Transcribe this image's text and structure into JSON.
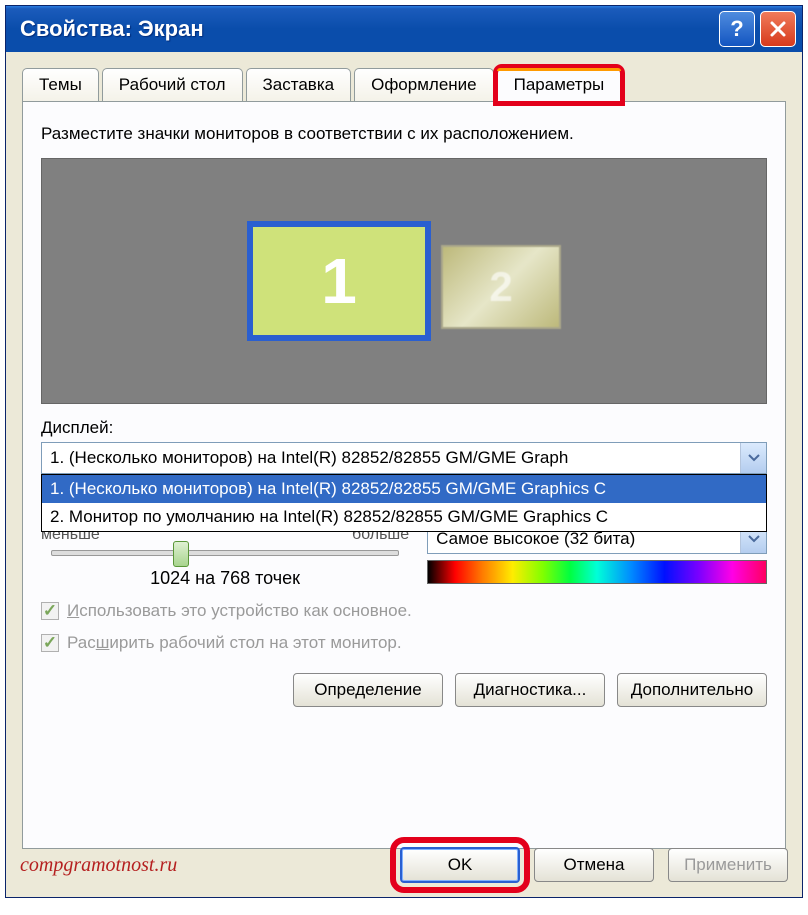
{
  "window": {
    "title": "Свойства: Экран"
  },
  "tabs": {
    "themes": "Темы",
    "desktop": "Рабочий стол",
    "screensaver": "Заставка",
    "appearance": "Оформление",
    "settings": "Параметры"
  },
  "panel": {
    "instruction": "Разместите значки мониторов в соответствии с их расположением.",
    "mon1": "1",
    "mon2": "2",
    "display_label": "Дисплей:",
    "display_value": "1. (Несколько мониторов) на Intel(R) 82852/82855 GM/GME Graph",
    "dropdown": {
      "opt1": "1. (Несколько мониторов) на Intel(R) 82852/82855 GM/GME Graphics C",
      "opt2": "2. Монитор по умолчанию на Intel(R) 82852/82855 GM/GME Graphics C"
    },
    "less": "меньше",
    "more": "больше",
    "resolution": "1024 на 768 точек",
    "color_quality": "Самое высокое (32 бита)",
    "chk_primary": "Использовать это устройство как основное.",
    "chk_extend": "Расширить рабочий стол на этот монитор.",
    "btn_identify": "Определение",
    "btn_troubleshoot": "Диагностика...",
    "btn_advanced": "Дополнительно"
  },
  "footer": {
    "watermark": "compgramotnost.ru",
    "ok": "OK",
    "cancel": "Отмена",
    "apply": "Применить"
  }
}
